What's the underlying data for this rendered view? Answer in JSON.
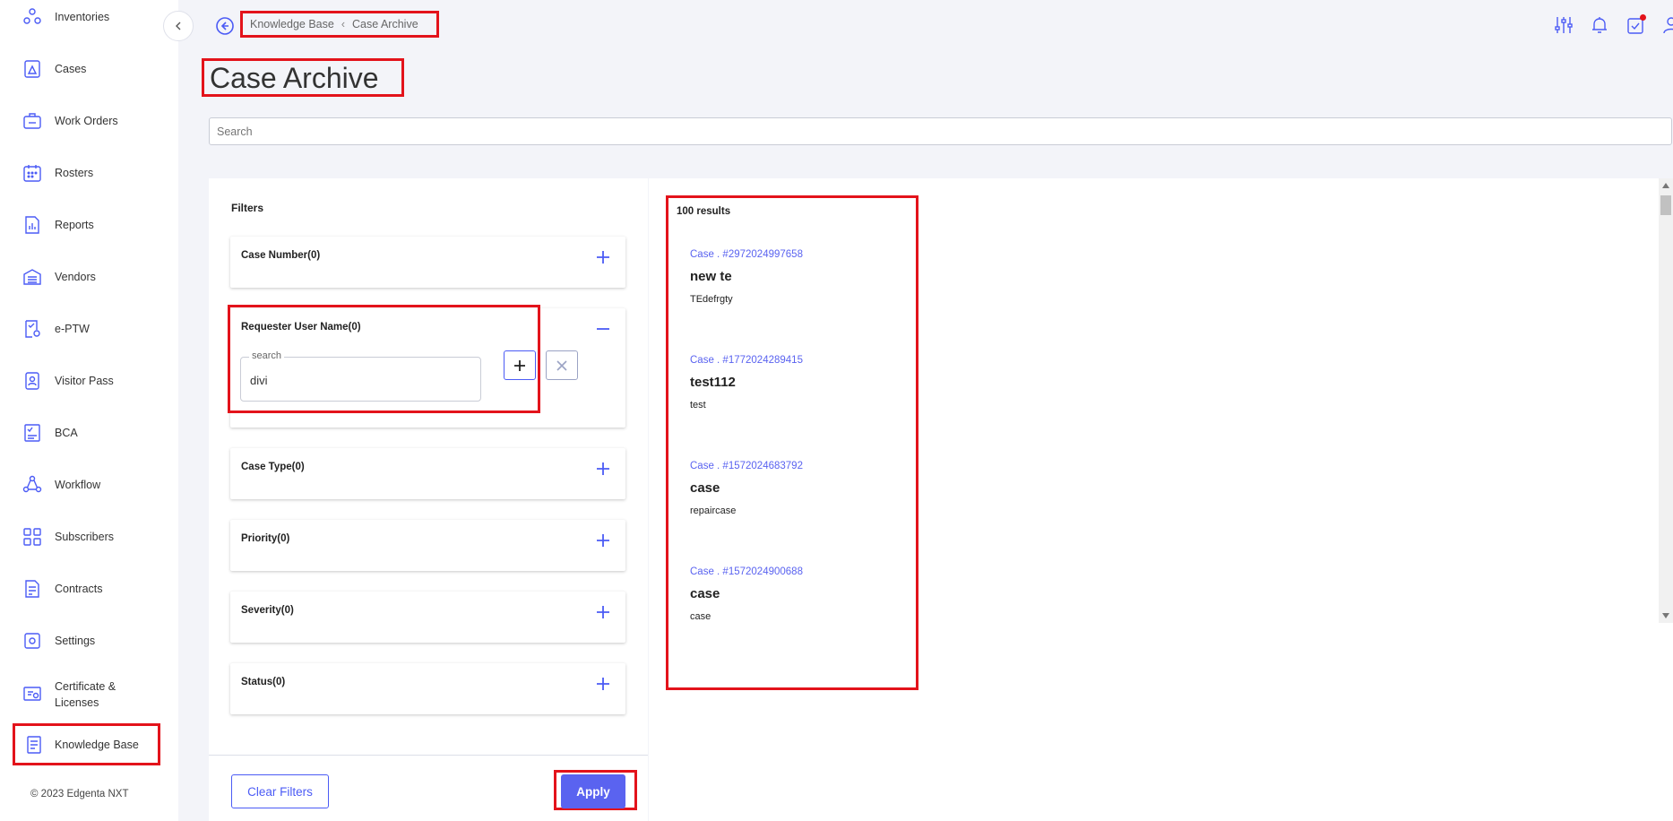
{
  "colors": {
    "accent": "#5a63f0",
    "highlight": "#e3131b",
    "sidebar_bg": "#ffffff",
    "page_bg": "#f3f4f9"
  },
  "sidebar": {
    "items": [
      {
        "label": "Inventories",
        "icon": "inventories-icon"
      },
      {
        "label": "Cases",
        "icon": "cases-icon"
      },
      {
        "label": "Work Orders",
        "icon": "work-orders-icon"
      },
      {
        "label": "Rosters",
        "icon": "rosters-icon"
      },
      {
        "label": "Reports",
        "icon": "reports-icon"
      },
      {
        "label": "Vendors",
        "icon": "vendors-icon"
      },
      {
        "label": "e-PTW",
        "icon": "eptw-icon"
      },
      {
        "label": "Visitor Pass",
        "icon": "visitor-pass-icon"
      },
      {
        "label": "BCA",
        "icon": "bca-icon"
      },
      {
        "label": "Workflow",
        "icon": "workflow-icon"
      },
      {
        "label": "Subscribers",
        "icon": "subscribers-icon"
      },
      {
        "label": "Contracts",
        "icon": "contracts-icon"
      },
      {
        "label": "Settings",
        "icon": "settings-icon"
      },
      {
        "label": "Certificate &",
        "label2": "Licenses",
        "icon": "certificate-icon"
      },
      {
        "label": "Knowledge Base",
        "icon": "knowledge-base-icon",
        "active": true
      }
    ],
    "copyright": "© 2023 Edgenta NXT"
  },
  "header": {
    "breadcrumb": {
      "root": "Knowledge Base",
      "current": "Case Archive"
    },
    "title": "Case Archive",
    "icons": [
      "filter-sliders-icon",
      "bell-icon",
      "task-check-icon",
      "user-icon"
    ]
  },
  "search": {
    "placeholder": "Search"
  },
  "filters": {
    "title": "Filters",
    "groups": [
      {
        "label": "Case Number(0)"
      },
      {
        "label": "Requester User Name(0)",
        "expanded": true,
        "search_legend": "search",
        "search_value": "divi"
      },
      {
        "label": "Case Type(0)"
      },
      {
        "label": "Priority(0)"
      },
      {
        "label": "Severity(0)"
      },
      {
        "label": "Status(0)"
      }
    ],
    "clear_label": "Clear Filters",
    "apply_label": "Apply"
  },
  "results": {
    "count_label": "100 results",
    "items": [
      {
        "id": "Case . #2972024997658",
        "title": "new te",
        "desc": "TEdefrgty"
      },
      {
        "id": "Case . #1772024289415",
        "title": "test112",
        "desc": "test"
      },
      {
        "id": "Case . #1572024683792",
        "title": "case",
        "desc": "repaircase"
      },
      {
        "id": "Case . #1572024900688",
        "title": "case",
        "desc": "case"
      }
    ]
  }
}
